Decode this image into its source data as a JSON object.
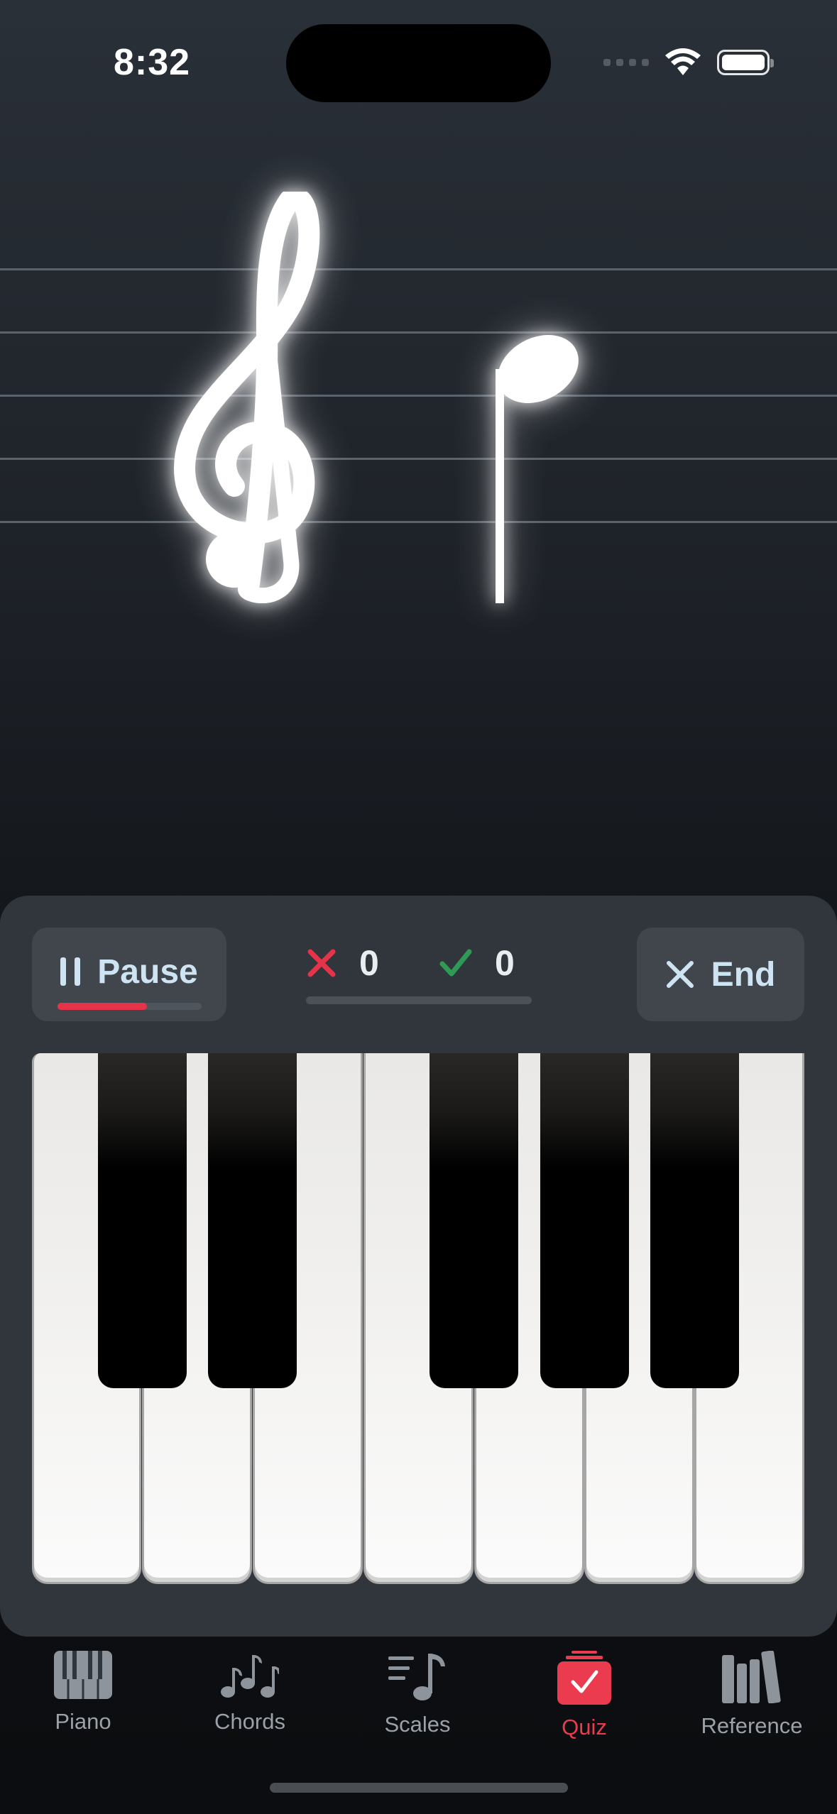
{
  "status": {
    "time": "8:32"
  },
  "quiz": {
    "pause_label": "Pause",
    "end_label": "End",
    "pause_progress": 0.62,
    "wrong_count": "0",
    "correct_count": "0",
    "score_progress": 0
  },
  "colors": {
    "accent": "#e5334a",
    "correct": "#2e9a55",
    "button_text": "#cfe4f2"
  },
  "tabs": [
    {
      "label": "Piano",
      "icon": "piano-icon"
    },
    {
      "label": "Chords",
      "icon": "chords-icon"
    },
    {
      "label": "Scales",
      "icon": "scales-icon"
    },
    {
      "label": "Quiz",
      "icon": "quiz-icon",
      "active": true
    },
    {
      "label": "Reference",
      "icon": "reference-icon"
    }
  ]
}
